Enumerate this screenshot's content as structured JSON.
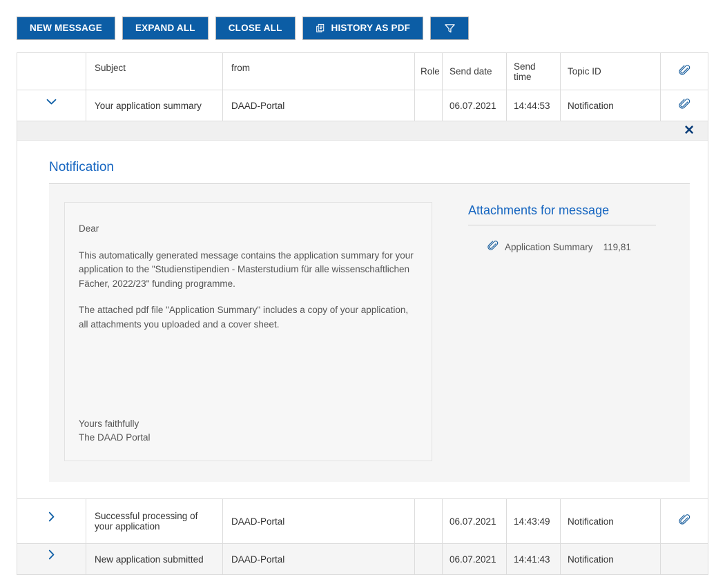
{
  "toolbar": {
    "new_message": "NEW MESSAGE",
    "expand_all": "EXPAND ALL",
    "close_all": "CLOSE ALL",
    "history_as_pdf": "HISTORY AS PDF",
    "history_icon": "print-document-icon",
    "filter_icon": "funnel-filter-icon",
    "accent_color": "#0c5da5"
  },
  "table": {
    "headers": {
      "toggle": "",
      "subject": "Subject",
      "from": "from",
      "role": "Role",
      "send_date": "Send date",
      "send_time": "Send time",
      "topic_id": "Topic ID",
      "attachment_icon": "paperclip-icon"
    },
    "rows": [
      {
        "toggle_icon": "chevron-down-icon",
        "subject": "Your application summary",
        "from": "DAAD-Portal",
        "role": "",
        "send_date": "06.07.2021",
        "send_time": "14:44:53",
        "topic_id": "Notification",
        "has_attachment": true
      },
      {
        "toggle_icon": "chevron-right-icon",
        "subject": "Successful processing of your application",
        "from": "DAAD-Portal",
        "role": "",
        "send_date": "06.07.2021",
        "send_time": "14:43:49",
        "topic_id": "Notification",
        "has_attachment": true
      },
      {
        "toggle_icon": "chevron-right-icon",
        "subject": "New application submitted",
        "from": "DAAD-Portal",
        "role": "",
        "send_date": "06.07.2021",
        "send_time": "14:41:43",
        "topic_id": "Notification",
        "has_attachment": false
      }
    ]
  },
  "detail": {
    "close_label": "✕",
    "title": "Notification",
    "message": {
      "salutation": "Dear",
      "paragraph1": "This automatically generated message contains the application summary for your application to the \"Studienstipendien - Masterstudium für alle wissenschaftlichen Fächer, 2022/23\" funding programme.",
      "paragraph2": "The attached pdf file \"Application Summary\" includes a copy of your application, all attachments you uploaded and a cover sheet.",
      "closing_line1": "Yours faithfully",
      "closing_line2": "The DAAD Portal"
    },
    "attachments": {
      "title": "Attachments for message",
      "items": [
        {
          "icon": "paperclip-icon",
          "name": "Application Summary",
          "size": "119,81"
        }
      ]
    }
  }
}
